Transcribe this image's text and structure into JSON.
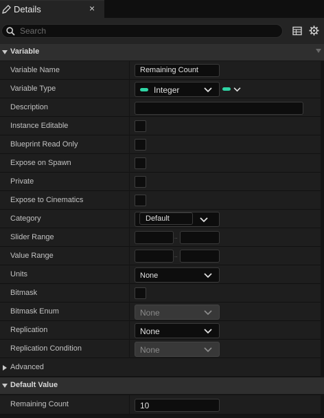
{
  "tab": {
    "title": "Details",
    "close": "×"
  },
  "search": {
    "placeholder": "Search"
  },
  "sections": {
    "variable": "Variable",
    "default_value": "Default Value"
  },
  "rows": {
    "variable_name": {
      "label": "Variable Name",
      "value": "Remaining Count"
    },
    "variable_type": {
      "label": "Variable Type",
      "value": "Integer",
      "pill_color": "#2fd4a4"
    },
    "description": {
      "label": "Description",
      "value": ""
    },
    "instance_editable": {
      "label": "Instance Editable",
      "checked": false
    },
    "blueprint_read_only": {
      "label": "Blueprint Read Only",
      "checked": false
    },
    "expose_on_spawn": {
      "label": "Expose on Spawn",
      "checked": false
    },
    "private": {
      "label": "Private",
      "checked": false
    },
    "expose_to_cinematics": {
      "label": "Expose to Cinematics",
      "checked": false
    },
    "category": {
      "label": "Category",
      "value": "Default"
    },
    "slider_range": {
      "label": "Slider Range",
      "min": "",
      "max": "",
      "separator": ".."
    },
    "value_range": {
      "label": "Value Range",
      "min": "",
      "max": "",
      "separator": ".."
    },
    "units": {
      "label": "Units",
      "value": "None"
    },
    "bitmask": {
      "label": "Bitmask",
      "checked": false
    },
    "bitmask_enum": {
      "label": "Bitmask Enum",
      "value": "None"
    },
    "replication": {
      "label": "Replication",
      "value": "None"
    },
    "replication_condition": {
      "label": "Replication Condition",
      "value": "None"
    },
    "advanced": {
      "label": "Advanced"
    },
    "remaining_count": {
      "label": "Remaining Count",
      "value": "10"
    }
  },
  "icons": [
    "pencil-icon",
    "close-icon",
    "search-icon",
    "table-icon",
    "gear-icon",
    "collapse-arrow-icon",
    "expand-arrow-icon",
    "chevron-down-icon"
  ]
}
